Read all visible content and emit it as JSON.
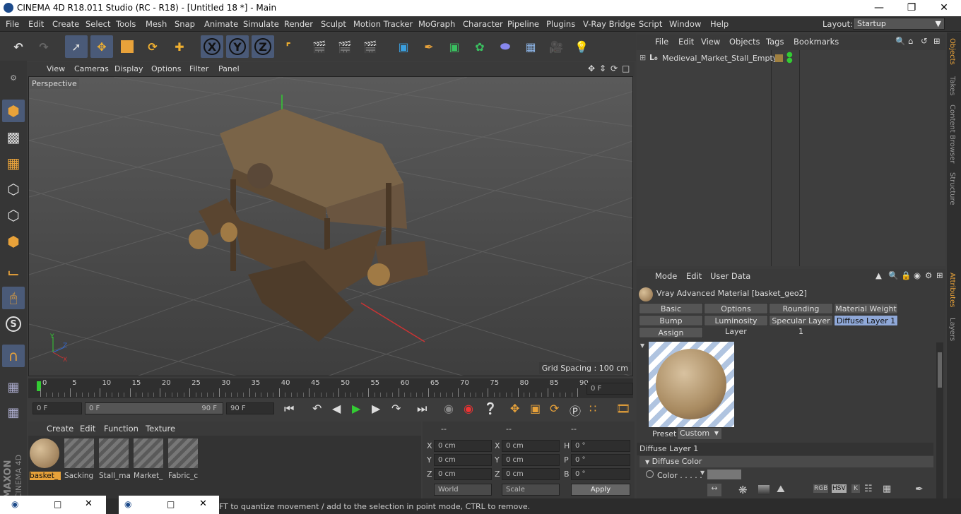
{
  "window": {
    "title": "CINEMA 4D R18.011 Studio (RC - R18) - [Untitled 18 *] - Main"
  },
  "menubar": {
    "items": [
      "File",
      "Edit",
      "Create",
      "Select",
      "Tools",
      "Mesh",
      "Snap",
      "Animate",
      "Simulate",
      "Render",
      "Sculpt",
      "Motion Tracker",
      "MoGraph",
      "Character",
      "Pipeline",
      "Plugins",
      "V-Ray Bridge",
      "Script",
      "Window",
      "Help"
    ],
    "layout_label": "Layout:",
    "layout_value": "Startup"
  },
  "viewport": {
    "menu": [
      "View",
      "Cameras",
      "Display",
      "Options",
      "Filter",
      "Panel"
    ],
    "camera_label": "Perspective",
    "grid_spacing": "Grid Spacing : 100 cm"
  },
  "timeline": {
    "ticks": [
      "0",
      "5",
      "10",
      "15",
      "20",
      "25",
      "30",
      "35",
      "40",
      "45",
      "50",
      "55",
      "60",
      "65",
      "70",
      "75",
      "80",
      "85",
      "90"
    ],
    "current_frame": "0 F",
    "start_field": "0 F",
    "range_start": "0 F",
    "range_end": "90 F",
    "end_field": "90 F"
  },
  "material_manager": {
    "menu": [
      "Create",
      "Edit",
      "Function",
      "Texture"
    ],
    "materials": [
      "basket_",
      "Sacking",
      "Stall_ma",
      "Market_",
      "Fabric_c"
    ]
  },
  "coordinates": {
    "headers": [
      "--",
      "--",
      "--"
    ],
    "rows": [
      {
        "a": "X",
        "av": "0 cm",
        "b": "X",
        "bv": "0 cm",
        "c": "H",
        "cv": "0 °"
      },
      {
        "a": "Y",
        "av": "0 cm",
        "b": "Y",
        "bv": "0 cm",
        "c": "P",
        "cv": "0 °"
      },
      {
        "a": "Z",
        "av": "0 cm",
        "b": "Z",
        "bv": "0 cm",
        "c": "B",
        "cv": "0 °"
      }
    ],
    "space": "World",
    "mode": "Scale",
    "apply": "Apply"
  },
  "objects": {
    "menu": [
      "File",
      "Edit",
      "View",
      "Objects",
      "Tags",
      "Bookmarks"
    ],
    "tree": [
      {
        "label": "Medieval_Market_Stall_Empty"
      }
    ]
  },
  "attributes": {
    "menu": [
      "Mode",
      "Edit",
      "User Data"
    ],
    "material_title": "Vray Advanced Material [basket_geo2]",
    "tabs_row1": [
      "Basic",
      "Options",
      "Rounding",
      "Material Weight"
    ],
    "tabs_row2": [
      "Bump",
      "Luminosity Layer",
      "Specular Layer 1",
      "Diffuse Layer 1"
    ],
    "tabs_row3": [
      "Assign"
    ],
    "preset_label": "Preset",
    "preset_value": "Custom",
    "section": "Diffuse Layer 1",
    "subsection": "Diffuse Color",
    "color_label": "Color . . . . ."
  },
  "sidetabs": {
    "top": [
      "Objects",
      "Takes",
      "Content Browser",
      "Structure"
    ],
    "bottom": [
      "Attributes",
      "Layers"
    ]
  },
  "status": {
    "text": "FT to quantize movement / add to the selection in point mode, CTRL to remove."
  },
  "branding": {
    "maxon": "MAXON",
    "cinema": "CINEMA 4D"
  },
  "colors": {
    "accent": "#8fa8d8",
    "selected_orange": "#e8a23a"
  }
}
